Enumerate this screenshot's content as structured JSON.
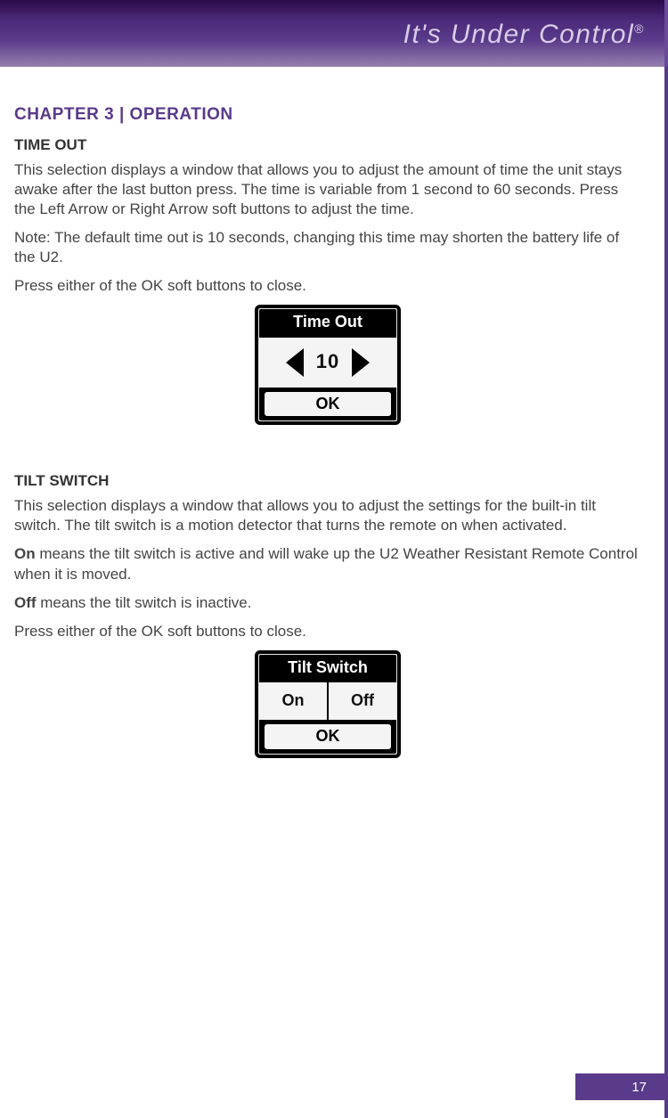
{
  "header": {
    "tagline": "It's Under Control",
    "registered": "®"
  },
  "chapter": "CHAPTER 3   |   OPERATION",
  "timeout": {
    "heading": "TIME OUT",
    "para1": "This selection displays a window that allows you to adjust the amount of time the unit stays awake after the last button press. The time is variable from 1 second to 60 seconds. Press the Left Arrow or Right Arrow soft buttons to adjust the time.",
    "para2": "Note:  The default time out is 10 seconds, changing this time may shorten the battery life of the U2.",
    "para3": "Press either of the OK soft buttons to close.",
    "lcd": {
      "title": "Time Out",
      "value": "10",
      "ok": "OK"
    }
  },
  "tilt": {
    "heading": "TILT SWITCH",
    "para1": "This selection displays a window that allows you to adjust the settings for the built-in tilt switch. The tilt switch is a motion detector that turns the remote on when activated.",
    "on_label": "On",
    "on_text": " means the tilt switch is active and will wake up the U2 Weather Resistant Remote Control when it is moved.",
    "off_label": "Off",
    "off_text": " means the tilt switch is inactive.",
    "para4": "Press either of the OK soft buttons to close.",
    "lcd": {
      "title": "Tilt Switch",
      "on": "On",
      "off": "Off",
      "ok": "OK"
    }
  },
  "page_number": "17"
}
